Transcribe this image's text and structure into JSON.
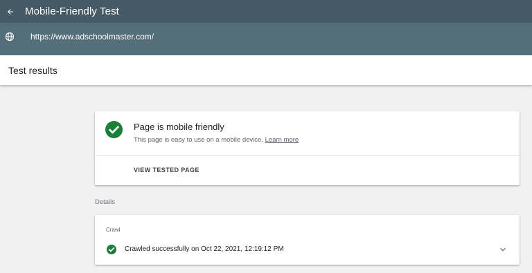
{
  "app": {
    "title": "Mobile-Friendly Test",
    "url": "https://www.adschoolmaster.com/"
  },
  "results": {
    "title": "Test results"
  },
  "status": {
    "title": "Page is mobile friendly",
    "subtitle": "This page is easy to use on a mobile device.",
    "learn_more": "Learn more",
    "view_tested_page": "VIEW TESTED PAGE"
  },
  "details": {
    "label": "Details",
    "crawl": {
      "label": "Crawl",
      "status_text": "Crawled successfully on Oct 22, 2021, 12:19:12 PM"
    }
  },
  "colors": {
    "topbar": "#455a64",
    "urlbar": "#546e7a",
    "success": "#188038"
  },
  "icons": {
    "back": "arrow-back-icon",
    "globe": "globe-icon",
    "check": "check-circle-icon",
    "expand": "chevron-down-icon"
  }
}
